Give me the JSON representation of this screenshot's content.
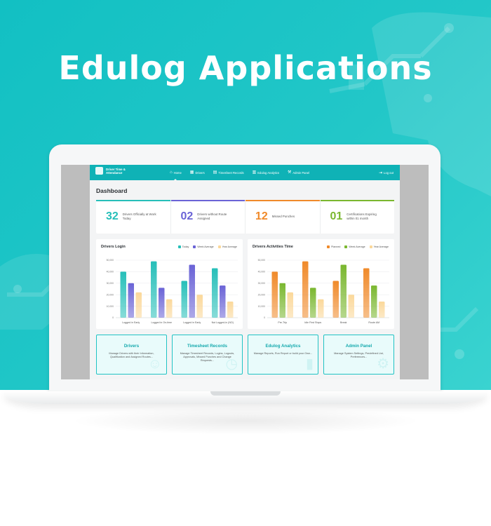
{
  "headline": "Edulog Applications",
  "colors": {
    "hero_bg": "#1cc3c5",
    "topbar": "#0fb2b6",
    "accent_teal": "#26bfb9",
    "accent_purple": "#6a63d6",
    "accent_orange": "#f08a2a",
    "accent_green": "#7ab72f",
    "year_avg": "#fbd89a"
  },
  "app": {
    "brand": "Driver Time & Attendance",
    "nav": [
      {
        "label": "Home",
        "icon": "home-icon",
        "active": true
      },
      {
        "label": "Drivers",
        "icon": "chart-icon"
      },
      {
        "label": "Timesheet Records",
        "icon": "timesheet-icon"
      },
      {
        "label": "Edulog Analytics",
        "icon": "analytics-icon"
      },
      {
        "label": "Admin Panel",
        "icon": "wrench-icon"
      }
    ],
    "logout": "Log out",
    "page_title": "Dashboard",
    "stats": [
      {
        "value": "32",
        "label": "Drivers Officially at Work Today",
        "color": "#26bfb9"
      },
      {
        "value": "02",
        "label": "Drivers without Route Assigned",
        "color": "#6a63d6"
      },
      {
        "value": "12",
        "label": "Missed Punches",
        "color": "#f08a2a"
      },
      {
        "value": "01",
        "label": "Certifications Expiring within 01 month",
        "color": "#7ab72f"
      }
    ],
    "tiles": [
      {
        "title": "Drivers",
        "desc": "Manage Drivers with their Information, Qualification and Assigned Routes..."
      },
      {
        "title": "Timesheet Records",
        "desc": "Manage Timesheet Records, Logins, Logouts, Approvals, Missed Punches and Change Requests..."
      },
      {
        "title": "Edulog Analytics",
        "desc": "Manage Reports, Run Report or build your Own..."
      },
      {
        "title": "Admin Panel",
        "desc": "Manage System Settings, Predefined List, Preferences..."
      }
    ]
  },
  "chart_data": [
    {
      "type": "bar",
      "title": "Drivers Login",
      "categories": [
        "Logged in Early",
        "Logged in On-time",
        "Logged in Early",
        "Not Logged-in (NO)"
      ],
      "series": [
        {
          "name": "Today",
          "values": [
            40000,
            49000,
            32000,
            43000
          ],
          "color": "#26bfb9"
        },
        {
          "name": "Week Average",
          "values": [
            30000,
            26000,
            46000,
            28000
          ],
          "color": "#6a63d6"
        },
        {
          "name": "Year Average",
          "values": [
            22000,
            16000,
            20000,
            14000
          ],
          "color": "#fbd89a"
        }
      ],
      "y_ticks": [
        "0",
        "10,000",
        "20,000",
        "30,000",
        "40,000",
        "50,000"
      ],
      "ylim": [
        0,
        50000
      ],
      "legend": "top-right",
      "grid": true
    },
    {
      "type": "bar",
      "title": "Drivers Activities Time",
      "categories": [
        "Pre-Trip",
        "Idle First Stops",
        "Break",
        "Route AM"
      ],
      "series": [
        {
          "name": "Planned",
          "values": [
            40000,
            49000,
            32000,
            43000
          ],
          "color": "#f08a2a"
        },
        {
          "name": "Week Average",
          "values": [
            30000,
            26000,
            46000,
            28000
          ],
          "color": "#7ab72f"
        },
        {
          "name": "Year Average",
          "values": [
            22000,
            16000,
            20000,
            14000
          ],
          "color": "#fbd89a"
        }
      ],
      "y_ticks": [
        "0",
        "10,000",
        "20,000",
        "30,000",
        "40,000",
        "50,000"
      ],
      "ylim": [
        0,
        50000
      ],
      "legend": "top-right",
      "grid": true
    }
  ]
}
